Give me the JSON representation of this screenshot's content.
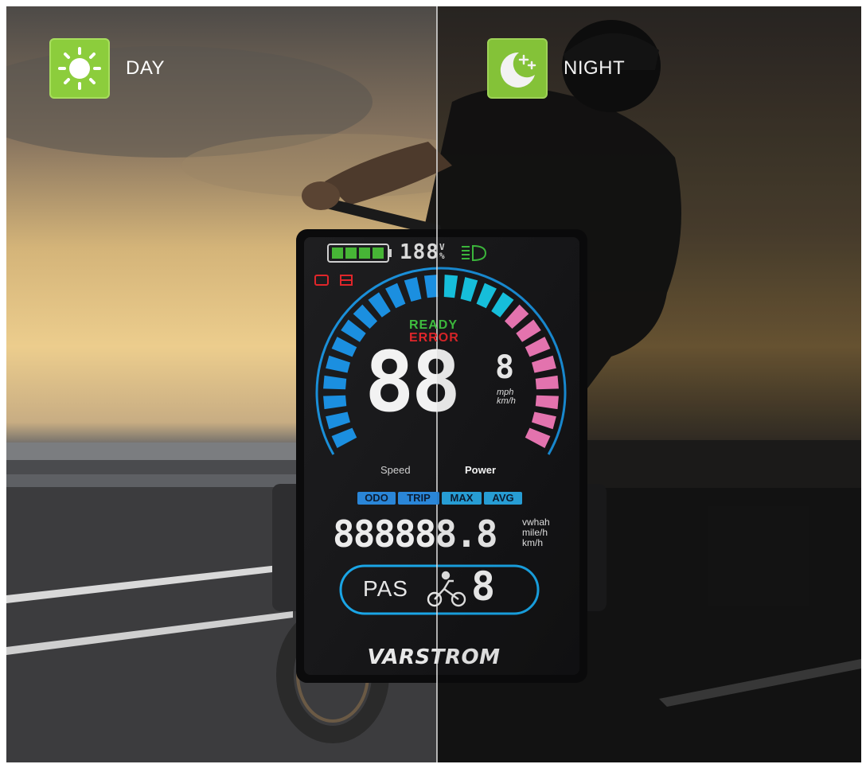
{
  "day_label": "DAY",
  "night_label": "NIGHT",
  "icons": {
    "day": "sun-icon",
    "night": "moon-stars-icon"
  },
  "display": {
    "battery_readout": "188",
    "battery_units": [
      "V",
      "%"
    ],
    "status_ready": "READY",
    "status_error": "ERROR",
    "speed_main": "88",
    "speed_small": "8",
    "speed_units": [
      "mph",
      "km/h"
    ],
    "gauge_left_label": "Speed",
    "gauge_right_label": "Power",
    "modes": [
      "ODO",
      "TRIP",
      "MAX",
      "AVG"
    ],
    "odometer": "888888.8",
    "odometer_units": [
      "vwhah",
      "mile/h",
      "km/h"
    ],
    "pas_label": "PAS",
    "pas_level": "8",
    "brand": "VARSTROM"
  },
  "colors": {
    "ready": "#3fbf3f",
    "error": "#e0262a",
    "gauge_blue": "#1b8fe0",
    "gauge_cyan": "#18c9e6",
    "gauge_pink": "#f07ab8",
    "mode_tabs": "#2a86d8",
    "badge_green": "#8ccd3c"
  }
}
